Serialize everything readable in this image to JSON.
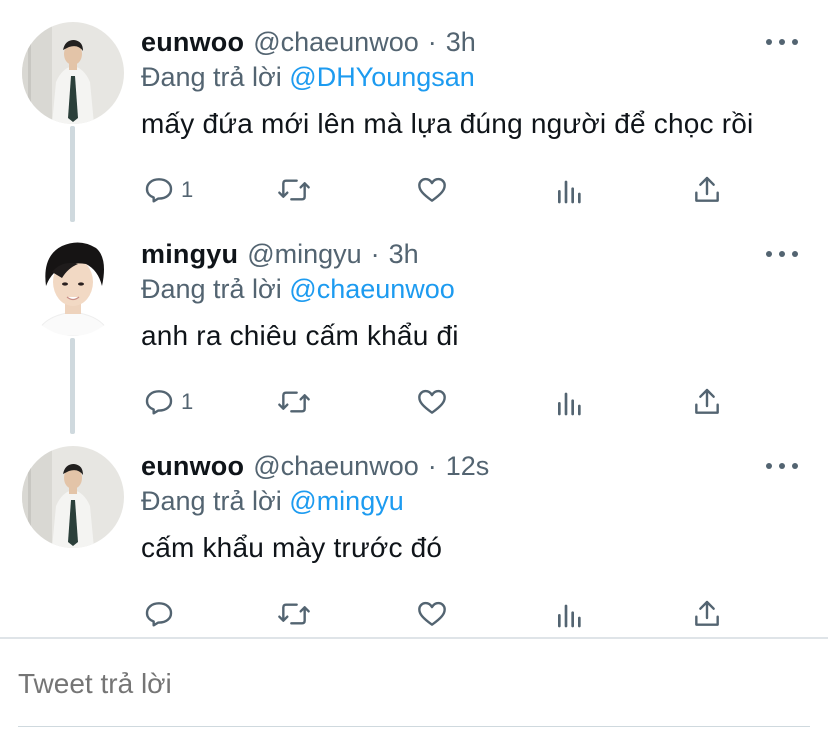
{
  "tweets": [
    {
      "name": "eunwoo",
      "handle": "@chaeunwoo",
      "time": "3h",
      "replying_prefix": "Đang trả lời",
      "replying_to": "@DHYoungsan",
      "text": "mấy đứa mới lên mà lựa đúng người để chọc rồi",
      "reply_count": "1",
      "avatar": "avatar-photo-eunwoo"
    },
    {
      "name": "mingyu",
      "handle": "@mingyu",
      "time": "3h",
      "replying_prefix": "Đang trả lời",
      "replying_to": "@chaeunwoo",
      "text": "anh ra chiêu cấm khẩu đi",
      "reply_count": "1",
      "avatar": "avatar-photo-mingyu"
    },
    {
      "name": "eunwoo",
      "handle": "@chaeunwoo",
      "time": "12s",
      "replying_prefix": "Đang trả lời",
      "replying_to": "@mingyu",
      "text": "cấm khẩu mày trước đó",
      "reply_count": "",
      "avatar": "avatar-photo-eunwoo"
    }
  ],
  "separator": "·",
  "reply_box": {
    "placeholder": "Tweet trả lời"
  },
  "colors": {
    "link": "#1d9bf0",
    "muted": "#536471",
    "text": "#0f1419",
    "thread_line": "#cfd9de"
  }
}
